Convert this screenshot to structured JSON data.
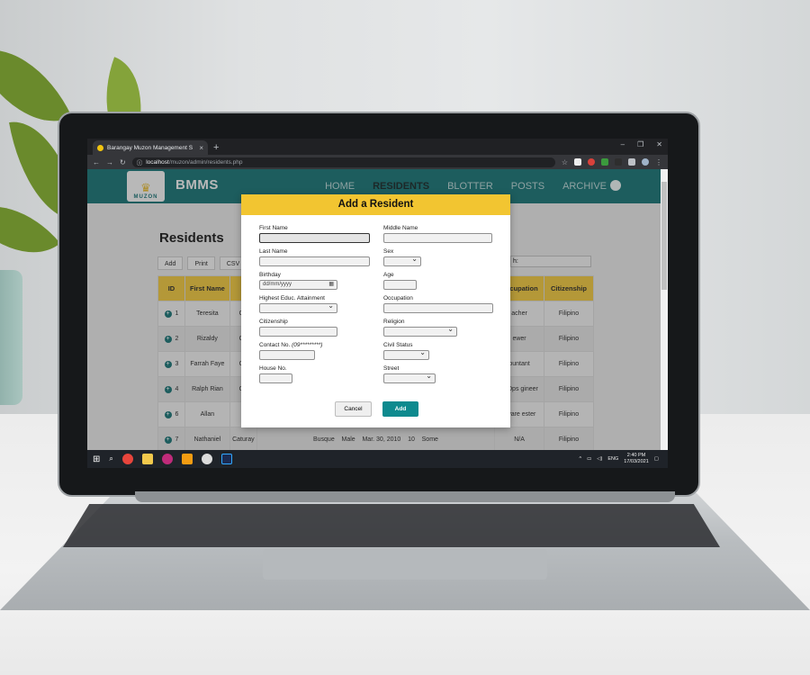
{
  "browser": {
    "tab_title": "Barangay Muzon Management S",
    "tab_close": "×",
    "new_tab": "+",
    "url_host": "localhost",
    "url_path": "/muzon/admin/residents.php",
    "win_min": "–",
    "win_restore": "❐",
    "win_close": "✕",
    "nav_back": "←",
    "nav_forward": "→",
    "nav_reload": "↻",
    "info_icon": "ⓘ",
    "star": "☆",
    "menu": "⋮"
  },
  "site": {
    "logo_text": "MUZON",
    "brand": "BMMS",
    "nav": [
      "HOME",
      "RESIDENTS",
      "BLOTTER",
      "POSTS",
      "ARCHIVE"
    ]
  },
  "residents_page": {
    "title": "Residents",
    "buttons": [
      "Add",
      "Print",
      "CSV"
    ],
    "search_label": "h:",
    "columns_left": [
      "ID",
      "First Name",
      "A"
    ],
    "columns_right": [
      "Occupation",
      "Citizenship"
    ],
    "rows": [
      {
        "id": "1",
        "first": "Teresita",
        "a": "Go",
        "occ": "acher",
        "cit": "Filipino"
      },
      {
        "id": "2",
        "first": "Rizaldy",
        "a": "Go",
        "occ": "ewer",
        "cit": "Filipino"
      },
      {
        "id": "3",
        "first": "Farrah Faye",
        "a": "Go",
        "occ": "ountant",
        "cit": "Filipino"
      },
      {
        "id": "4",
        "first": "Ralph Rian",
        "a": "Go",
        "occ": "evOps gineer",
        "cit": "Filipino"
      },
      {
        "id": "6",
        "first": "Allan",
        "a": "A",
        "occ": "ftware ester",
        "cit": "Filipino"
      },
      {
        "id": "7",
        "first": "Nathaniel",
        "a": "Caturay",
        "occ": "N/A",
        "cit": "Filipino"
      }
    ],
    "partial_row_extra": [
      "Busque",
      "Male",
      "Mar. 30, 2010",
      "10",
      "Some"
    ]
  },
  "modal": {
    "title": "Add a Resident",
    "fields": {
      "first_name": "First Name",
      "middle_name": "Middle Name",
      "last_name": "Last Name",
      "sex": "Sex",
      "birthday": "Birthday",
      "birthday_placeholder": "dd/mm/yyyy",
      "age": "Age",
      "education": "Highest Educ. Attainment",
      "occupation": "Occupation",
      "citizenship": "Citizenship",
      "religion": "Religion",
      "contact": "Contact No.",
      "contact_hint": "(09*********)",
      "civil_status": "Civil Status",
      "house_no": "House No.",
      "street": "Street"
    },
    "cancel_label": "Cancel",
    "add_label": "Add"
  },
  "taskbar": {
    "lang": "ENG",
    "time": "2:40 PM",
    "date": "17/03/2021"
  },
  "colors": {
    "header_teal": "#0f6d6f",
    "accent_yellow": "#f2c531",
    "add_button": "#0e8a8e"
  }
}
